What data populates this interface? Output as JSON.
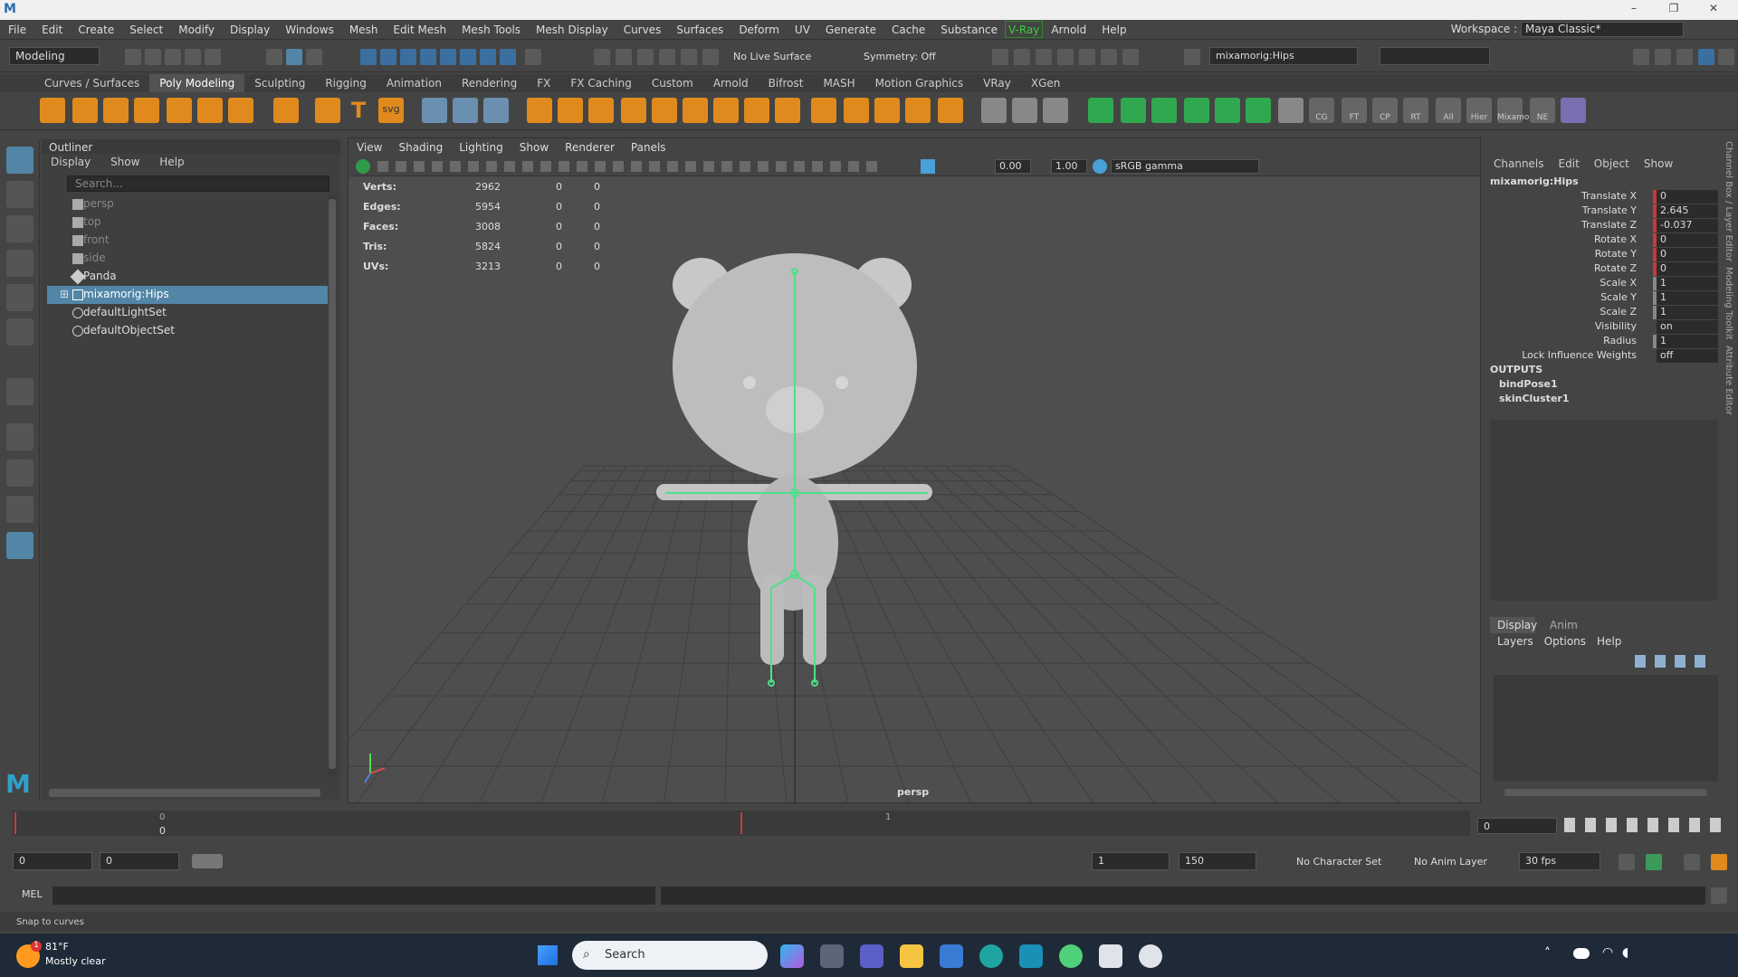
{
  "menubar": [
    "File",
    "Edit",
    "Create",
    "Select",
    "Modify",
    "Display",
    "Windows",
    "Mesh",
    "Edit Mesh",
    "Mesh Tools",
    "Mesh Display",
    "Curves",
    "Surfaces",
    "Deform",
    "UV",
    "Generate",
    "Cache",
    "Substance",
    "V-Ray",
    "Arnold",
    "Help"
  ],
  "workspace": {
    "label": "Workspace :",
    "value": "Maya Classic*"
  },
  "status": {
    "mode": "Modeling",
    "live_surface": "No Live Surface",
    "symmetry": "Symmetry: Off",
    "selected_object": "mixamorig:Hips"
  },
  "shelf_tabs": [
    "Curves / Surfaces",
    "Poly Modeling",
    "Sculpting",
    "Rigging",
    "Animation",
    "Rendering",
    "FX",
    "FX Caching",
    "Custom",
    "Arnold",
    "Bifrost",
    "MASH",
    "Motion Graphics",
    "VRay",
    "XGen"
  ],
  "shelf_labels": [
    "T",
    "svg",
    "CG",
    "FT",
    "CP",
    "RT",
    "All",
    "Hier",
    "Mixamo",
    "NE"
  ],
  "outliner": {
    "title": "Outliner",
    "menu": [
      "Display",
      "Show",
      "Help"
    ],
    "search_placeholder": "Search...",
    "items": [
      "persp",
      "top",
      "front",
      "side",
      "Panda",
      "mixamorig:Hips",
      "defaultLightSet",
      "defaultObjectSet"
    ]
  },
  "viewport": {
    "menu": [
      "View",
      "Shading",
      "Lighting",
      "Show",
      "Renderer",
      "Panels"
    ],
    "near": "0.00",
    "far": "1.00",
    "color_space": "sRGB gamma",
    "camera_label": "persp",
    "hud": [
      {
        "label": "Verts:",
        "v": "2962",
        "a": "0",
        "b": "0"
      },
      {
        "label": "Edges:",
        "v": "5954",
        "a": "0",
        "b": "0"
      },
      {
        "label": "Faces:",
        "v": "3008",
        "a": "0",
        "b": "0"
      },
      {
        "label": "Tris:",
        "v": "5824",
        "a": "0",
        "b": "0"
      },
      {
        "label": "UVs:",
        "v": "3213",
        "a": "0",
        "b": "0"
      }
    ]
  },
  "channelbox": {
    "menu": [
      "Channels",
      "Edit",
      "Object",
      "Show"
    ],
    "object": "mixamorig:Hips",
    "attrs": [
      {
        "l": "Translate X",
        "v": "0"
      },
      {
        "l": "Translate Y",
        "v": "2.645"
      },
      {
        "l": "Translate Z",
        "v": "-0.037"
      },
      {
        "l": "Rotate X",
        "v": "0"
      },
      {
        "l": "Rotate Y",
        "v": "0"
      },
      {
        "l": "Rotate Z",
        "v": "0"
      },
      {
        "l": "Scale X",
        "v": "1"
      },
      {
        "l": "Scale Y",
        "v": "1"
      },
      {
        "l": "Scale Z",
        "v": "1"
      },
      {
        "l": "Visibility",
        "v": "on"
      },
      {
        "l": "Radius",
        "v": "1"
      },
      {
        "l": "Lock Influence Weights",
        "v": "off"
      }
    ],
    "outputs_label": "OUTPUTS",
    "outputs": [
      "bindPose1",
      "skinCluster1"
    ]
  },
  "side_tabs": [
    "Channel Box / Layer Editor",
    "Modeling Toolkit",
    "Attribute Editor"
  ],
  "layers": {
    "tabs": [
      "Display",
      "Anim"
    ],
    "menu": [
      "Layers",
      "Options",
      "Help"
    ]
  },
  "timeline": {
    "start_tick": "0",
    "mid_tick": "1",
    "current_frame": "0",
    "current": "0"
  },
  "range": {
    "start": "0",
    "start2": "0",
    "anim_start": "1",
    "anim_end": "150",
    "char_set": "No Character Set",
    "anim_layer": "No Anim Layer",
    "fps": "30 fps"
  },
  "cmd": {
    "label": "MEL"
  },
  "help": {
    "text": "Snap to curves"
  },
  "taskbar": {
    "temp": "81°F",
    "weather": "Mostly clear",
    "search": "Search",
    "badge": "1"
  }
}
